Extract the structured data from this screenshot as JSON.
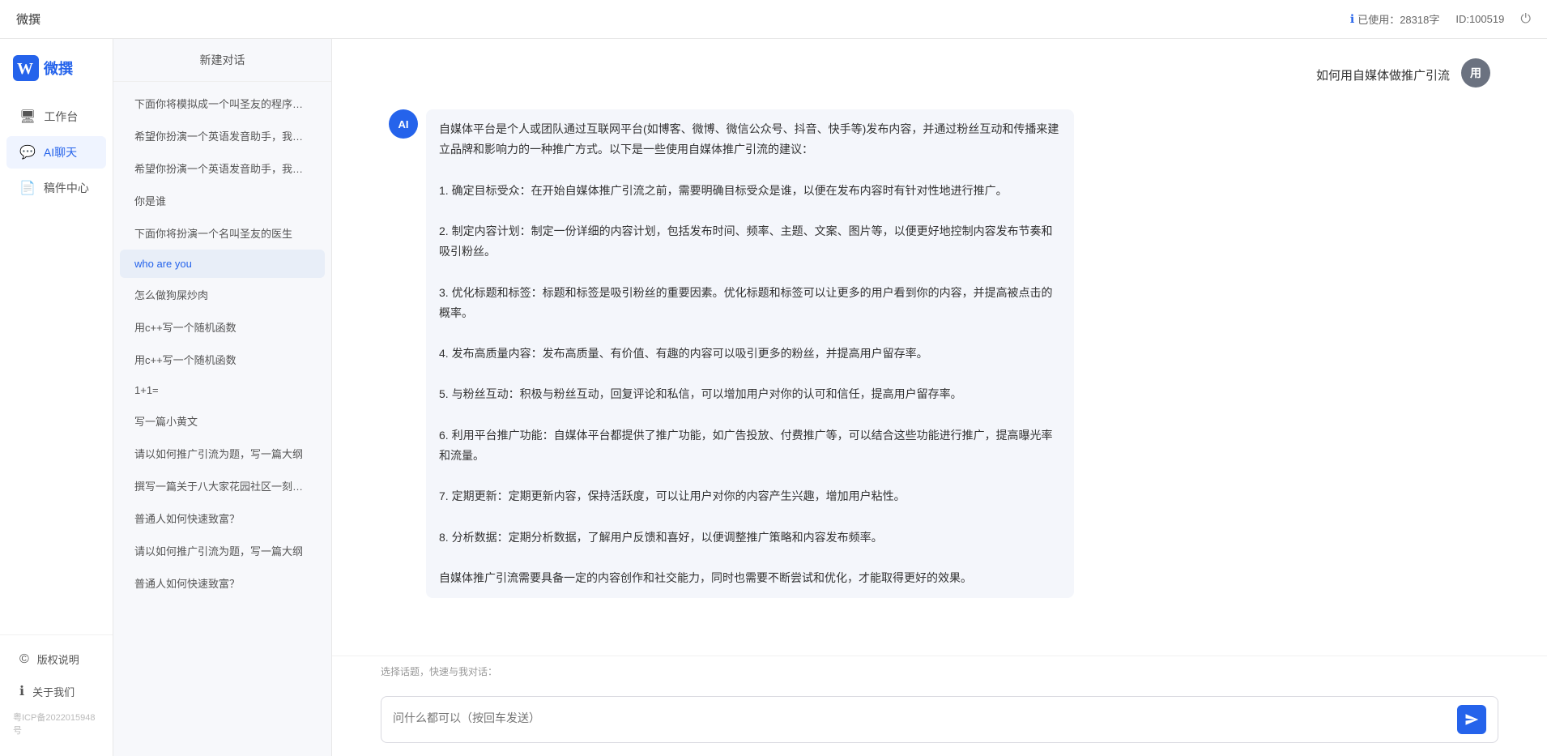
{
  "topbar": {
    "title": "微撰",
    "usage_label": "已使用：28318字",
    "id_label": "ID:100519",
    "usage_icon": "info-icon"
  },
  "nav": {
    "logo_text": "微撰",
    "items": [
      {
        "id": "workbench",
        "label": "工作台",
        "icon": "🖥"
      },
      {
        "id": "ai-chat",
        "label": "AI聊天",
        "icon": "💬",
        "active": true
      },
      {
        "id": "components",
        "label": "稿件中心",
        "icon": "📄"
      }
    ],
    "bottom_items": [
      {
        "id": "copyright",
        "label": "版权说明",
        "icon": "©"
      },
      {
        "id": "about",
        "label": "关于我们",
        "icon": "ℹ"
      }
    ],
    "icp": "粤ICP备2022015948号"
  },
  "sidebar": {
    "new_chat": "新建对话",
    "items": [
      {
        "id": "item-1",
        "label": "下面你将模拟成一个叫圣友的程序员，我说...",
        "active": false
      },
      {
        "id": "item-2",
        "label": "希望你扮演一个英语发音助手，我提供给你...",
        "active": false
      },
      {
        "id": "item-3",
        "label": "希望你扮演一个英语发音助手，我提供给你...",
        "active": false
      },
      {
        "id": "item-4",
        "label": "你是谁",
        "active": false
      },
      {
        "id": "item-5",
        "label": "下面你将扮演一个名叫圣友的医生",
        "active": false
      },
      {
        "id": "item-6",
        "label": "who are you",
        "active": true
      },
      {
        "id": "item-7",
        "label": "怎么做狗屎炒肉",
        "active": false
      },
      {
        "id": "item-8",
        "label": "用c++写一个随机函数",
        "active": false
      },
      {
        "id": "item-9",
        "label": "用c++写一个随机函数",
        "active": false
      },
      {
        "id": "item-10",
        "label": "1+1=",
        "active": false
      },
      {
        "id": "item-11",
        "label": "写一篇小黄文",
        "active": false
      },
      {
        "id": "item-12",
        "label": "请以如何推广引流为题，写一篇大纲",
        "active": false
      },
      {
        "id": "item-13",
        "label": "撰写一篇关于八大家花园社区一刻钟便民生...",
        "active": false
      },
      {
        "id": "item-14",
        "label": "普通人如何快速致富？",
        "active": false
      },
      {
        "id": "item-15",
        "label": "请以如何推广引流为题，写一篇大纲",
        "active": false
      },
      {
        "id": "item-16",
        "label": "普通人如何快速致富？",
        "active": false
      }
    ]
  },
  "chat": {
    "messages": [
      {
        "id": "msg-1",
        "role": "user",
        "avatar_text": "用",
        "text": "如何用自媒体做推广引流"
      },
      {
        "id": "msg-2",
        "role": "ai",
        "avatar_text": "AI",
        "text": "自媒体平台是个人或团队通过互联网平台(如博客、微博、微信公众号、抖音、快手等)发布内容，并通过粉丝互动和传播来建立品牌和影响力的一种推广方式。以下是一些使用自媒体推广引流的建议：\n\n1. 确定目标受众：在开始自媒体推广引流之前，需要明确目标受众是谁，以便在发布内容时有针对性地进行推广。\n\n2. 制定内容计划：制定一份详细的内容计划，包括发布时间、频率、主题、文案、图片等，以便更好地控制内容发布节奏和吸引粉丝。\n\n3. 优化标题和标签：标题和标签是吸引粉丝的重要因素。优化标题和标签可以让更多的用户看到你的内容，并提高被点击的概率。\n\n4. 发布高质量内容：发布高质量、有价值、有趣的内容可以吸引更多的粉丝，并提高用户留存率。\n\n5. 与粉丝互动：积极与粉丝互动，回复评论和私信，可以增加用户对你的认可和信任，提高用户留存率。\n\n6. 利用平台推广功能：自媒体平台都提供了推广功能，如广告投放、付费推广等，可以结合这些功能进行推广，提高曝光率和流量。\n\n7. 定期更新：定期更新内容，保持活跃度，可以让用户对你的内容产生兴趣，增加用户粘性。\n\n8. 分析数据：定期分析数据，了解用户反馈和喜好，以便调整推广策略和内容发布频率。\n\n自媒体推广引流需要具备一定的内容创作和社交能力，同时也需要不断尝试和优化，才能取得更好的效果。"
      }
    ],
    "quick_topics_label": "选择话题，快速与我对话：",
    "input_placeholder": "问什么都可以（按回车发送）"
  }
}
